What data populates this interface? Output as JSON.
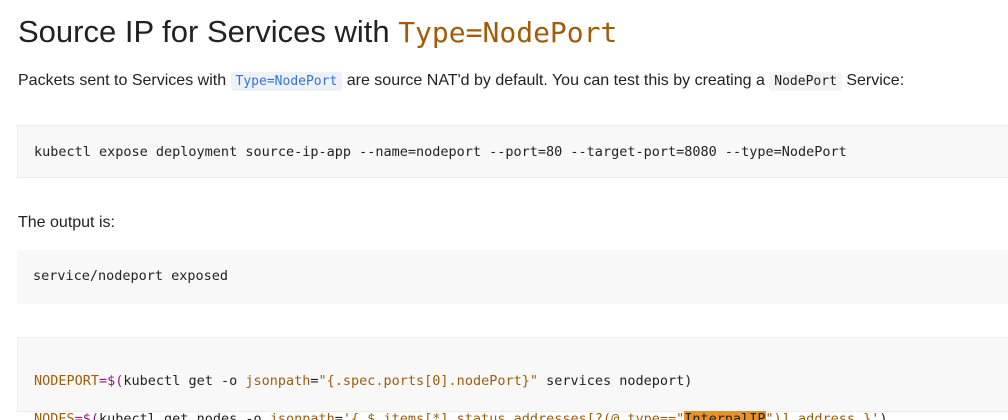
{
  "heading": {
    "text": "Source IP for Services with ",
    "code": "Type=NodePort"
  },
  "intro": {
    "part1": "Packets sent to Services with ",
    "code1": "Type=NodePort",
    "part2": " are source NAT'd by default. You can test this by creating a ",
    "code2": "NodePort",
    "part3": " Service:"
  },
  "block1": {
    "command": "kubectl expose deployment source-ip-app --name=nodeport --port=80 --target-port=8080 --type=NodePort"
  },
  "output_label": "The output is:",
  "block2": {
    "output": "service/nodeport exposed"
  },
  "block3": {
    "line1": {
      "var": "NODEPORT",
      "op": "=$(",
      "cmd": "kubectl get -o ",
      "flag": "jsonpath",
      "eq": "=",
      "str": "\"{.spec.ports[0].nodePort}\"",
      "rest": " services nodeport)"
    },
    "line2": {
      "var": "NODES",
      "op": "=$(",
      "cmd": "kubectl get nodes -o ",
      "flag": "jsonpath",
      "eq": "=",
      "str_a": "'{ $.items[*].status.addresses[?(@.type==\"",
      "highlight": "InternalIP",
      "str_b": "\")].address }'",
      "rest": ")"
    }
  },
  "colors": {
    "heading_code": "#a15c0a",
    "link_code": "#3371e3",
    "code_bg": "#f8f8f8",
    "highlight": "#e8902a",
    "operator": "#a0137e"
  }
}
